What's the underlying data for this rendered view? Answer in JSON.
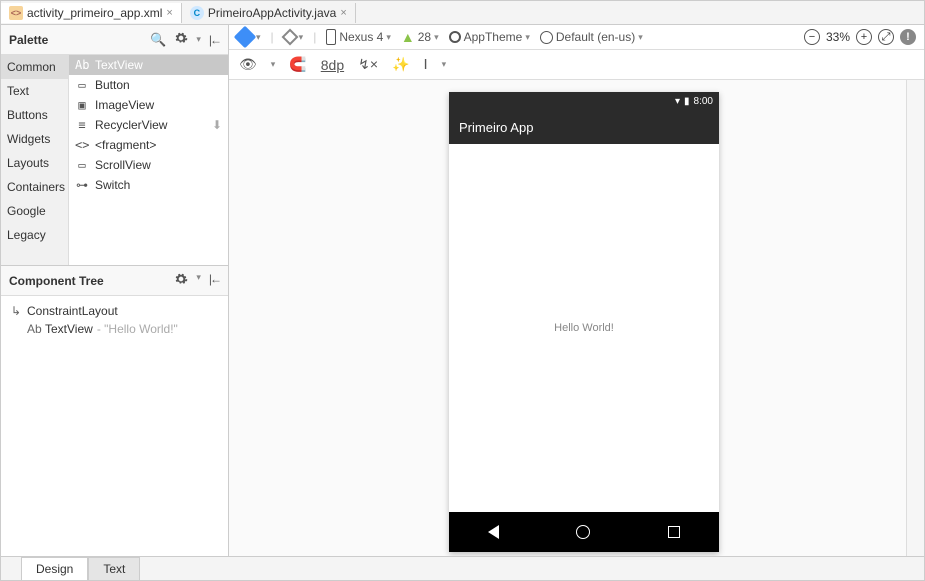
{
  "editor_tabs": [
    {
      "icon": "xml",
      "label": "activity_primeiro_app.xml",
      "active": true
    },
    {
      "icon": "java",
      "label": "PrimeiroAppActivity.java",
      "active": false
    }
  ],
  "palette": {
    "title": "Palette",
    "categories": [
      "Common",
      "Text",
      "Buttons",
      "Widgets",
      "Layouts",
      "Containers",
      "Google",
      "Legacy"
    ],
    "selected_category": "Common",
    "items": [
      {
        "icon": "Ab",
        "label": "TextView",
        "selected": true
      },
      {
        "icon": "▭",
        "label": "Button"
      },
      {
        "icon": "▣",
        "label": "ImageView"
      },
      {
        "icon": "≡",
        "label": "RecyclerView",
        "download": true
      },
      {
        "icon": "<>",
        "label": "<fragment>"
      },
      {
        "icon": "▭",
        "label": "ScrollView"
      },
      {
        "icon": "⊶",
        "label": "Switch"
      }
    ]
  },
  "component_tree": {
    "title": "Component Tree",
    "root": {
      "icon": "↳",
      "label": "ConstraintLayout"
    },
    "children": [
      {
        "icon": "Ab",
        "label": "TextView",
        "suffix": "- \"Hello World!\""
      }
    ]
  },
  "design_toolbar": {
    "device": "Nexus 4",
    "api": "28",
    "theme": "AppTheme",
    "locale": "Default (en-us)",
    "zoom": "33%"
  },
  "design_toolbar2": {
    "spacing": "8dp"
  },
  "device_preview": {
    "status_time": "8:00",
    "app_title": "Primeiro App",
    "body_text": "Hello World!"
  },
  "bottom_tabs": {
    "design": "Design",
    "text": "Text",
    "active": "Design"
  }
}
